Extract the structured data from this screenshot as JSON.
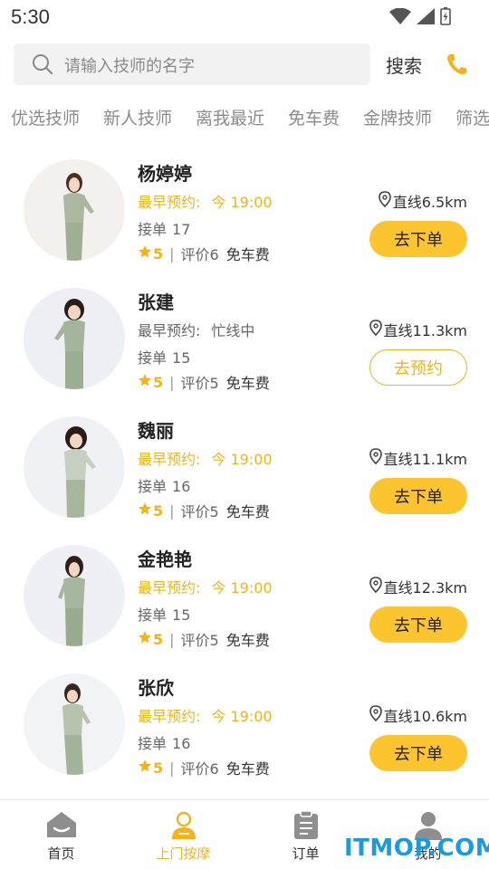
{
  "status_bar": {
    "time": "5:30"
  },
  "search": {
    "placeholder": "请输入技师的名字",
    "button_label": "搜索"
  },
  "filters": [
    {
      "label": "优选技师"
    },
    {
      "label": "新人技师"
    },
    {
      "label": "离我最近"
    },
    {
      "label": "免车费"
    },
    {
      "label": "金牌技师"
    },
    {
      "label": "筛选"
    }
  ],
  "technicians": [
    {
      "name": "杨婷婷",
      "earliest_label": "最早预约:",
      "earliest_value": "今 19:00",
      "earliest_highlight": true,
      "orders_label": "接单",
      "orders": "17",
      "rating": "5",
      "sep": "|",
      "reviews": "评价6",
      "free": "免车费",
      "distance": "直线6.5km",
      "action": "去下单",
      "action_style": "solid"
    },
    {
      "name": "张建",
      "earliest_label": "最早预约:",
      "earliest_value": "忙线中",
      "earliest_highlight": false,
      "orders_label": "接单",
      "orders": "15",
      "rating": "5",
      "sep": "|",
      "reviews": "评价5",
      "free": "免车费",
      "distance": "直线11.3km",
      "action": "去预约",
      "action_style": "outline"
    },
    {
      "name": "魏丽",
      "earliest_label": "最早预约:",
      "earliest_value": "今 19:00",
      "earliest_highlight": true,
      "orders_label": "接单",
      "orders": "16",
      "rating": "5",
      "sep": "|",
      "reviews": "评价5",
      "free": "免车费",
      "distance": "直线11.1km",
      "action": "去下单",
      "action_style": "solid"
    },
    {
      "name": "金艳艳",
      "earliest_label": "最早预约:",
      "earliest_value": "今 19:00",
      "earliest_highlight": true,
      "orders_label": "接单",
      "orders": "15",
      "rating": "5",
      "sep": "|",
      "reviews": "评价5",
      "free": "免车费",
      "distance": "直线12.3km",
      "action": "去下单",
      "action_style": "solid"
    },
    {
      "name": "张欣",
      "earliest_label": "最早预约:",
      "earliest_value": "今 19:00",
      "earliest_highlight": true,
      "orders_label": "接单",
      "orders": "16",
      "rating": "5",
      "sep": "|",
      "reviews": "评价6",
      "free": "免车费",
      "distance": "直线10.6km",
      "action": "去下单",
      "action_style": "solid"
    }
  ],
  "tab_bar": [
    {
      "label": "首页",
      "icon": "home-icon",
      "active": false
    },
    {
      "label": "上门按摩",
      "icon": "massage-icon",
      "active": true
    },
    {
      "label": "订单",
      "icon": "order-icon",
      "active": false
    },
    {
      "label": "我的",
      "icon": "profile-icon",
      "active": false
    }
  ],
  "watermark": "ITMOP.COM",
  "colors": {
    "accent": "#fcc530",
    "accent_text": "#f5b21a",
    "watermark": "#1a9be0"
  }
}
